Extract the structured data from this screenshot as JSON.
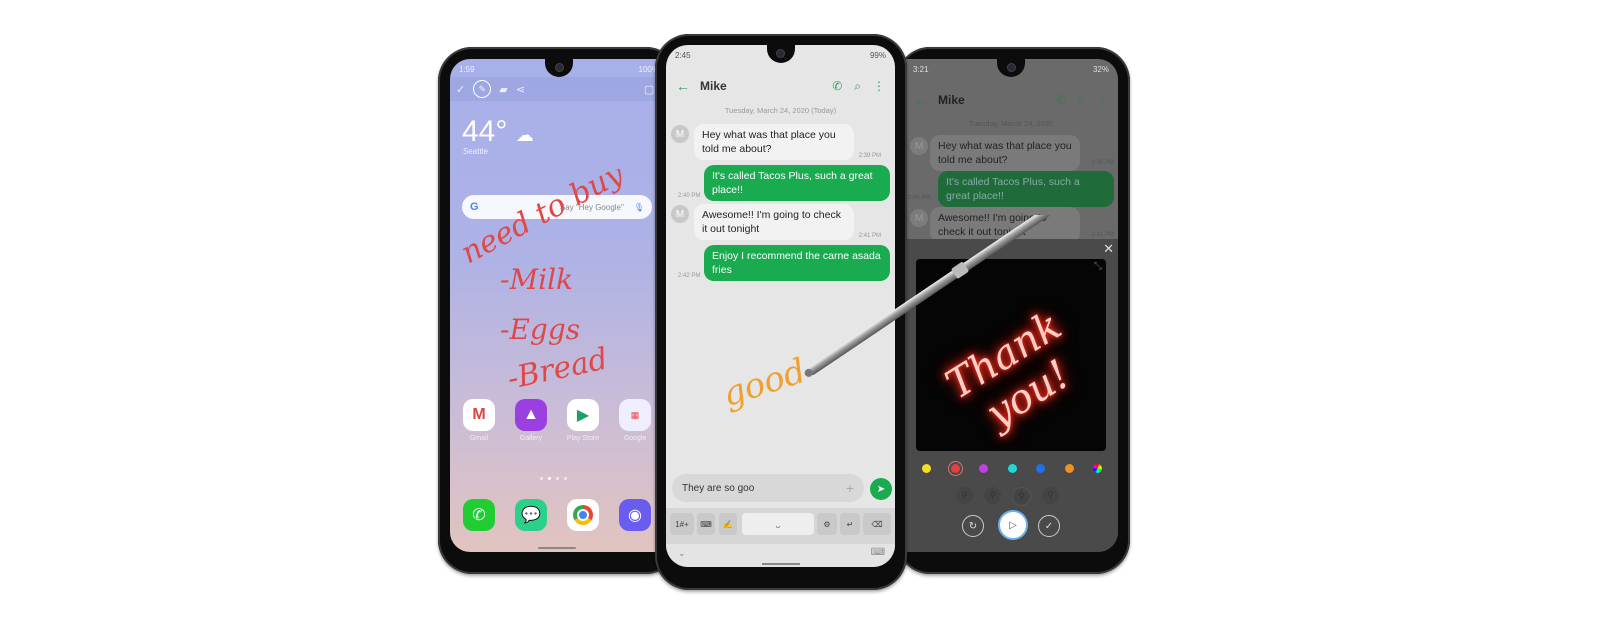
{
  "left_phone": {
    "status": {
      "time": "1:59",
      "battery": "100%"
    },
    "toolbar": {
      "icons": [
        "check-icon",
        "pen-icon",
        "eraser-icon",
        "share-icon",
        "crop-icon",
        "close-icon"
      ]
    },
    "weather": {
      "temperature": "44°",
      "city": "Seattle"
    },
    "search": {
      "placeholder": "Say \"Hey Google\""
    },
    "handwriting": {
      "lines": [
        "need to buy",
        "-Milk",
        "-Eggs",
        "-Bread"
      ],
      "color": "#e04848"
    },
    "apps": [
      {
        "label": "Gmail"
      },
      {
        "label": "Gallery"
      },
      {
        "label": "Play Store"
      },
      {
        "label": "Google"
      }
    ],
    "page_indicator": {
      "count": 4,
      "current": 2
    },
    "dock": [
      "phone-icon",
      "messages-icon",
      "chrome-icon",
      "camera-icon"
    ]
  },
  "middle_phone": {
    "status": {
      "time": "2:45",
      "battery": "99%"
    },
    "header": {
      "contact": "Mike"
    },
    "date_label": "Tuesday, March 24, 2020 (Today)",
    "messages": [
      {
        "dir": "in",
        "avatar": "M",
        "text": "Hey what was that place you told me about?",
        "time": "2:39 PM"
      },
      {
        "dir": "out",
        "text": "It's called Tacos Plus, such a great place!!",
        "time": "2:40 PM"
      },
      {
        "dir": "in",
        "avatar": "M",
        "text": "Awesome!! I'm going to check it out tonight",
        "time": "2:41 PM"
      },
      {
        "dir": "out",
        "text": "Enjoy I recommend the carne asada fries",
        "time": "2:42 PM"
      }
    ],
    "handwriting": {
      "text": "good",
      "color": "#f0a030"
    },
    "compose": {
      "value": "They are so goo"
    },
    "keyboard_keys": [
      "1#+",
      "keyboard-icon",
      "handwriting-icon",
      "space",
      "settings-icon",
      "enter-icon",
      "backspace-icon"
    ]
  },
  "right_phone": {
    "status": {
      "time": "3:21",
      "battery": "32%"
    },
    "header": {
      "contact": "Mike"
    },
    "date_label": "Tuesday, March 24, 2020",
    "messages": [
      {
        "dir": "in",
        "avatar": "M",
        "text": "Hey what was that place you told me about?",
        "time": "2:39 PM"
      },
      {
        "dir": "out",
        "text": "It's called Tacos Plus, such a great place!!",
        "time": "2:40 PM"
      },
      {
        "dir": "in",
        "avatar": "M",
        "text": "Awesome!! I'm going to check it out tonight",
        "time": "2:41 PM"
      }
    ],
    "live_message": {
      "text": "Thank you!",
      "color": "#ff5040"
    },
    "palette": [
      "#f5e020",
      "#e04040",
      "#c040e0",
      "#20d8d8",
      "#2070e8",
      "#f09020",
      "rainbow"
    ],
    "selected_color_index": 1
  }
}
